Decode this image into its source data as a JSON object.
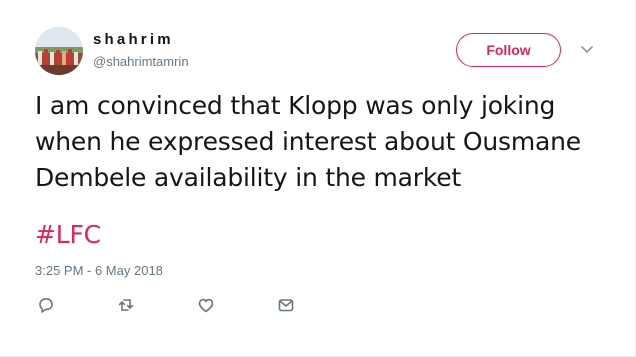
{
  "tweet": {
    "display_name": "shahrim",
    "handle": "@shahrimtamrin",
    "follow_label": "Follow",
    "text_lines": [
      "I am convinced that Klopp was only joking",
      "when he expressed interest about Ousmane",
      "Dembele availability in the market"
    ],
    "hashtag": "#LFC",
    "timestamp": "3:25 PM - 6 May 2018"
  },
  "icons": {
    "caret": "chevron-down-icon",
    "reply": "reply-icon",
    "retweet": "retweet-icon",
    "like": "heart-icon",
    "dm": "envelope-icon"
  },
  "colors": {
    "accent": "#e0245e",
    "text": "#14171a",
    "secondary": "#657786"
  }
}
